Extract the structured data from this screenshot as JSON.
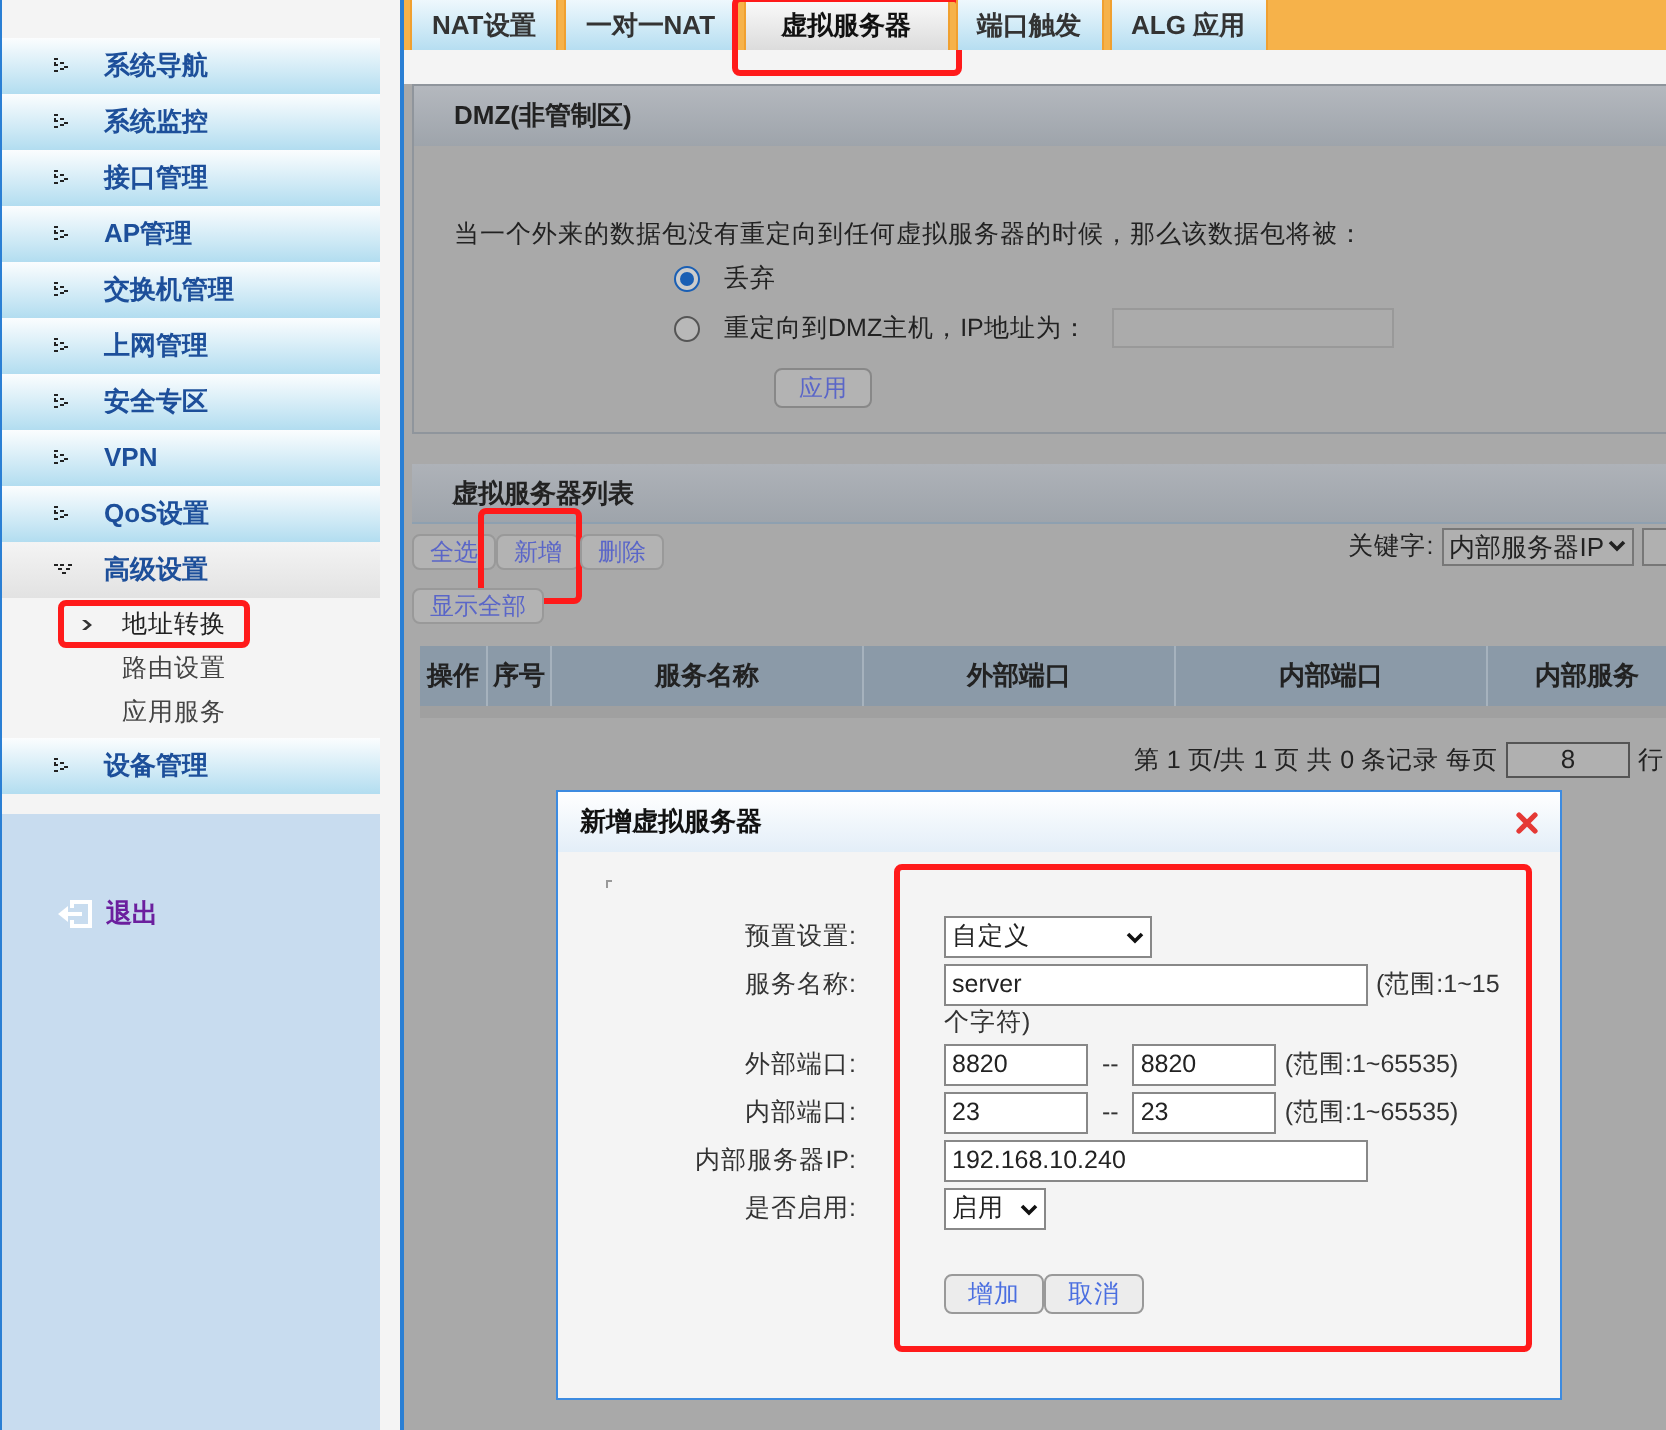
{
  "sidebar": {
    "items": [
      {
        "label": "系统导航",
        "expanded": false
      },
      {
        "label": "系统监控",
        "expanded": false
      },
      {
        "label": "接口管理",
        "expanded": false
      },
      {
        "label": "AP管理",
        "expanded": false
      },
      {
        "label": "交换机管理",
        "expanded": false
      },
      {
        "label": "上网管理",
        "expanded": false
      },
      {
        "label": "安全专区",
        "expanded": false
      },
      {
        "label": "VPN",
        "expanded": false
      },
      {
        "label": "QoS设置",
        "expanded": false
      },
      {
        "label": "高级设置",
        "expanded": true,
        "children": [
          {
            "label": "地址转换",
            "selected": true,
            "highlighted": true
          },
          {
            "label": "路由设置",
            "selected": false,
            "highlighted": false
          },
          {
            "label": "应用服务",
            "selected": false,
            "highlighted": false
          }
        ]
      },
      {
        "label": "设备管理",
        "expanded": false
      }
    ],
    "logout": "退出"
  },
  "tabs": [
    {
      "label": "NAT设置",
      "selected": false,
      "highlighted": false
    },
    {
      "label": "一对一NAT",
      "selected": false,
      "highlighted": false
    },
    {
      "label": "虚拟服务器",
      "selected": true,
      "highlighted": true
    },
    {
      "label": "端口触发",
      "selected": false,
      "highlighted": false
    },
    {
      "label": "ALG 应用",
      "selected": false,
      "highlighted": false
    }
  ],
  "dmz": {
    "title": "DMZ(非管制区)",
    "description": "当一个外来的数据包没有重定向到任何虚拟服务器的时候，那么该数据包将被：",
    "options": [
      {
        "label": "丢弃",
        "selected": true
      },
      {
        "label": "重定向到DMZ主机，IP地址为：",
        "selected": false
      }
    ],
    "apply_button": "应用"
  },
  "list": {
    "title": "虚拟服务器列表",
    "buttons": [
      {
        "label": "全选",
        "highlighted": false
      },
      {
        "label": "新增",
        "highlighted": true
      },
      {
        "label": "删除",
        "highlighted": false
      },
      {
        "label": "显示全部",
        "highlighted": false
      }
    ],
    "keyword_label": "关键字:",
    "keyword_value": "内部服务器IP",
    "columns": [
      "操作",
      "序号",
      "服务名称",
      "外部端口",
      "内部端口",
      "内部服务"
    ],
    "pagination": "第 1 页/共 1 页 共 0 条记录 每页",
    "per_page": "8",
    "per_page_unit": "行"
  },
  "dialog": {
    "title": "新增虚拟服务器",
    "form_highlighted": true,
    "fields": [
      {
        "kind": "select",
        "label": "预置设置:",
        "value": "自定义"
      },
      {
        "kind": "text",
        "label": "服务名称:",
        "value": "server",
        "hint": "(范围:1~15",
        "hint_continued": "个字符)"
      },
      {
        "kind": "range",
        "label": "外部端口:",
        "from": "8820",
        "separator": "--",
        "to": "8820",
        "hint": "(范围:1~65535)"
      },
      {
        "kind": "range",
        "label": "内部端口:",
        "from": "23",
        "separator": "--",
        "to": "23",
        "hint": "(范围:1~65535)"
      },
      {
        "kind": "text",
        "label": "内部服务器IP:",
        "value": "192.168.10.240"
      },
      {
        "kind": "smallselect",
        "label": "是否启用:",
        "value": "启用"
      }
    ],
    "buttons": [
      "增加",
      "取消"
    ]
  }
}
